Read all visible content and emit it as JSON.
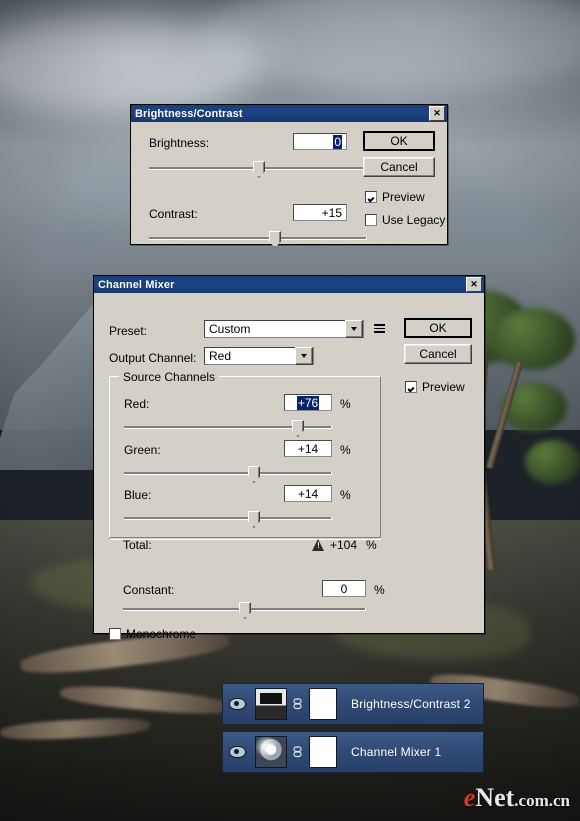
{
  "brightness_contrast": {
    "title": "Brightness/Contrast",
    "close_label": "✕",
    "brightness_label": "Brightness:",
    "brightness_value": "0",
    "contrast_label": "Contrast:",
    "contrast_value": "+15",
    "ok_label": "OK",
    "cancel_label": "Cancel",
    "preview_label": "Preview",
    "preview_checked": true,
    "use_legacy_label": "Use Legacy",
    "use_legacy_checked": false
  },
  "channel_mixer": {
    "title": "Channel Mixer",
    "close_label": "✕",
    "preset_label": "Preset:",
    "preset_value": "Custom",
    "output_channel_label": "Output Channel:",
    "output_channel_value": "Red",
    "source_channels_label": "Source Channels",
    "red_label": "Red:",
    "red_value": "+76",
    "red_unit": "%",
    "green_label": "Green:",
    "green_value": "+14",
    "green_unit": "%",
    "blue_label": "Blue:",
    "blue_value": "+14",
    "blue_unit": "%",
    "total_label": "Total:",
    "total_value": "+104",
    "total_unit": "%",
    "constant_label": "Constant:",
    "constant_value": "0",
    "constant_unit": "%",
    "monochrome_label": "Monochrome",
    "monochrome_checked": false,
    "ok_label": "OK",
    "cancel_label": "Cancel",
    "preview_label": "Preview",
    "preview_checked": true
  },
  "layers": [
    {
      "name": "Brightness/Contrast 2"
    },
    {
      "name": "Channel Mixer 1"
    }
  ],
  "watermark": {
    "e": "e",
    "net": "Net",
    "rest": ".com.cn"
  },
  "colors": {
    "titlebar": "#1b4486",
    "dialog_face": "#d4d0c8",
    "selection": "#0a246a",
    "layer_panel": "#2f4a74",
    "watermark_accent": "#e03a1e"
  }
}
